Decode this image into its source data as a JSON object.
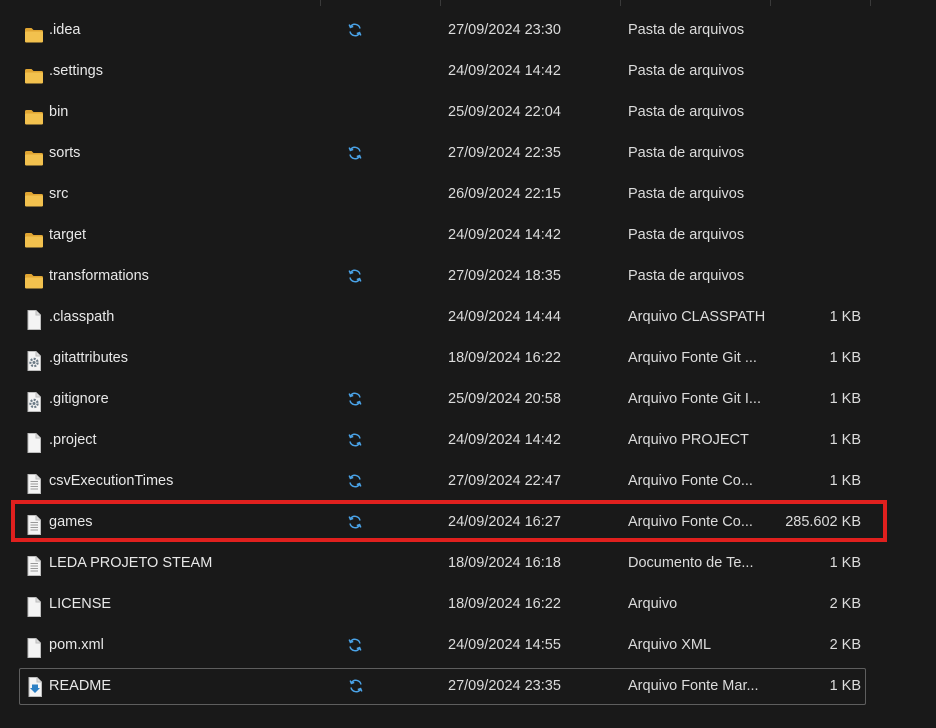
{
  "files": [
    {
      "name": ".idea",
      "icon": "folder-icon",
      "synced": true,
      "date": "27/09/2024 23:30",
      "type": "Pasta de arquivos",
      "size": ""
    },
    {
      "name": ".settings",
      "icon": "folder-icon",
      "synced": false,
      "date": "24/09/2024 14:42",
      "type": "Pasta de arquivos",
      "size": ""
    },
    {
      "name": "bin",
      "icon": "folder-icon",
      "synced": false,
      "date": "25/09/2024 22:04",
      "type": "Pasta de arquivos",
      "size": ""
    },
    {
      "name": "sorts",
      "icon": "folder-icon",
      "synced": true,
      "date": "27/09/2024 22:35",
      "type": "Pasta de arquivos",
      "size": ""
    },
    {
      "name": "src",
      "icon": "folder-icon",
      "synced": false,
      "date": "26/09/2024 22:15",
      "type": "Pasta de arquivos",
      "size": ""
    },
    {
      "name": "target",
      "icon": "folder-icon",
      "synced": false,
      "date": "24/09/2024 14:42",
      "type": "Pasta de arquivos",
      "size": ""
    },
    {
      "name": "transformations",
      "icon": "folder-icon",
      "synced": true,
      "date": "27/09/2024 18:35",
      "type": "Pasta de arquivos",
      "size": ""
    },
    {
      "name": ".classpath",
      "icon": "blank-file-icon",
      "synced": false,
      "date": "24/09/2024 14:44",
      "type": "Arquivo CLASSPATH",
      "size": "1 KB"
    },
    {
      "name": ".gitattributes",
      "icon": "gear-file-icon",
      "synced": false,
      "date": "18/09/2024 16:22",
      "type": "Arquivo Fonte Git ...",
      "size": "1 KB"
    },
    {
      "name": ".gitignore",
      "icon": "gear-file-icon",
      "synced": true,
      "date": "25/09/2024 20:58",
      "type": "Arquivo Fonte Git I...",
      "size": "1 KB"
    },
    {
      "name": ".project",
      "icon": "blank-file-icon",
      "synced": true,
      "date": "24/09/2024 14:42",
      "type": "Arquivo PROJECT",
      "size": "1 KB"
    },
    {
      "name": "csvExecutionTimes",
      "icon": "text-file-icon",
      "synced": true,
      "date": "27/09/2024 22:47",
      "type": "Arquivo Fonte Co...",
      "size": "1 KB"
    },
    {
      "name": "games",
      "icon": "text-file-icon",
      "synced": true,
      "date": "24/09/2024 16:27",
      "type": "Arquivo Fonte Co...",
      "size": "285.602 KB"
    },
    {
      "name": "LEDA PROJETO STEAM",
      "icon": "text-file-icon",
      "synced": false,
      "date": "18/09/2024 16:18",
      "type": "Documento de Te...",
      "size": "1 KB"
    },
    {
      "name": "LICENSE",
      "icon": "blank-file-icon",
      "synced": false,
      "date": "18/09/2024 16:22",
      "type": "Arquivo",
      "size": "2 KB"
    },
    {
      "name": "pom.xml",
      "icon": "blank-file-icon",
      "synced": true,
      "date": "24/09/2024 14:55",
      "type": "Arquivo XML",
      "size": "2 KB"
    },
    {
      "name": "README",
      "icon": "markdown-file-icon",
      "synced": true,
      "date": "27/09/2024 23:35",
      "type": "Arquivo Fonte Mar...",
      "size": "1 KB"
    }
  ],
  "selected_index": 16,
  "highlighted_index": 12,
  "colors": {
    "background": "#191919",
    "folder": "#f2c14e",
    "sync": "#4aa3e8",
    "highlight": "#e0201e",
    "selection_border": "#5e5e5e"
  }
}
